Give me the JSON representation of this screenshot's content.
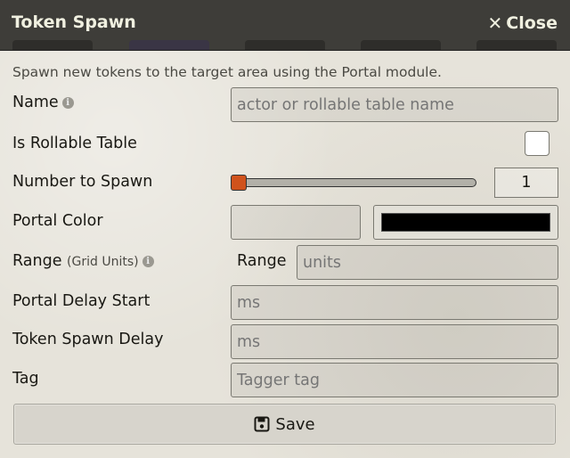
{
  "window": {
    "title": "Token Spawn",
    "close_label": "Close"
  },
  "intro": "Spawn new tokens to the target area using the Portal module.",
  "fields": {
    "name": {
      "label": "Name",
      "placeholder": "actor or rollable table name"
    },
    "rollable": {
      "label": "Is Rollable Table",
      "checked": false
    },
    "spawn_count": {
      "label": "Number to Spawn",
      "value": "1",
      "min_fraction": 0.0
    },
    "portal_color": {
      "label": "Portal Color",
      "value": "",
      "swatch_color": "#000000"
    },
    "range": {
      "label": "Range",
      "hint": "(Grid Units)",
      "inline_label": "Range",
      "placeholder": "units"
    },
    "portal_delay": {
      "label": "Portal Delay Start",
      "placeholder": "ms"
    },
    "token_delay": {
      "label": "Token Spawn Delay",
      "placeholder": "ms"
    },
    "tag": {
      "label": "Tag",
      "placeholder": "Tagger tag"
    }
  },
  "save_label": "Save",
  "colors": {
    "titlebar": "#3e3d39",
    "slider_thumb": "#d0521c",
    "background": "#e6e3da"
  }
}
